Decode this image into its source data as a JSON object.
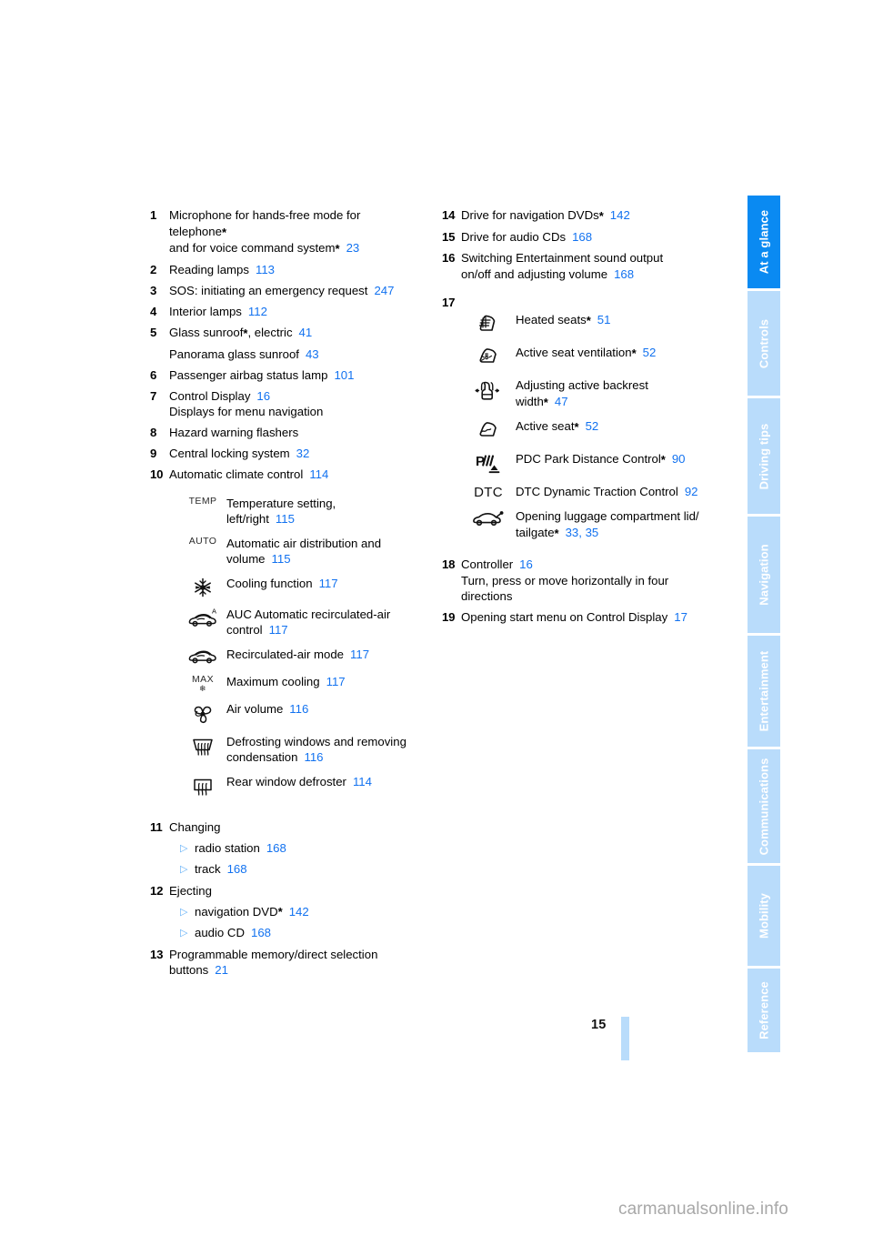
{
  "page": {
    "number": "15",
    "watermark": "carmanualsonline.info"
  },
  "tabs": [
    {
      "label": "At a glance",
      "active": true
    },
    {
      "label": "Controls",
      "active": false
    },
    {
      "label": "Driving tips",
      "active": false
    },
    {
      "label": "Navigation",
      "active": false
    },
    {
      "label": "Entertainment",
      "active": false
    },
    {
      "label": "Communications",
      "active": false
    },
    {
      "label": "Mobility",
      "active": false
    },
    {
      "label": "Reference",
      "active": false
    }
  ],
  "colors": {
    "reference_blue": "#1272f0",
    "tab_active": "#0a8af2",
    "tab_inactive": "#b9dcfb",
    "bullet_blue": "#63b0f7"
  },
  "left_column": {
    "items": [
      {
        "num": "1",
        "lines": [
          {
            "text": "Microphone for hands-free mode for"
          },
          {
            "text": "telephone",
            "star": true
          },
          {
            "text": "and for voice command system",
            "star": true,
            "ref": "23"
          }
        ]
      },
      {
        "num": "2",
        "lines": [
          {
            "text": "Reading lamps",
            "ref": "113"
          }
        ]
      },
      {
        "num": "3",
        "lines": [
          {
            "text": "SOS: initiating an emergency request",
            "ref": "247"
          }
        ]
      },
      {
        "num": "4",
        "lines": [
          {
            "text": "Interior lamps",
            "ref": "112"
          }
        ]
      },
      {
        "num": "5",
        "lines": [
          {
            "text": "Glass sunroof",
            "star": true,
            "suffix": ", electric",
            "ref": "41"
          },
          {
            "text": "Panorama glass sunroof",
            "ref": "43",
            "spaced": true
          }
        ]
      },
      {
        "num": "6",
        "lines": [
          {
            "text": "Passenger airbag status lamp",
            "ref": "101"
          }
        ]
      },
      {
        "num": "7",
        "lines": [
          {
            "text": "Control Display",
            "ref": "16"
          },
          {
            "text": "Displays for menu navigation"
          }
        ]
      },
      {
        "num": "8",
        "lines": [
          {
            "text": "Hazard warning flashers"
          }
        ]
      },
      {
        "num": "9",
        "lines": [
          {
            "text": "Central locking system",
            "ref": "32"
          }
        ]
      },
      {
        "num": "10",
        "lines": [
          {
            "text": "Automatic climate control",
            "ref": "114"
          }
        ]
      }
    ],
    "climate_icons": [
      {
        "icon": "temp-icon",
        "glyph": "TEMP",
        "line1": "Temperature setting,",
        "line2": "left/right",
        "ref": "115"
      },
      {
        "icon": "auto-icon",
        "glyph": "AUTO",
        "line1": "Automatic air distribution and",
        "line2": "volume",
        "ref": "115"
      },
      {
        "icon": "snowflake-icon",
        "line1": "Cooling function",
        "ref": "117"
      },
      {
        "icon": "auc-recirculation-icon",
        "line1": "AUC Automatic recirculated-air",
        "line2": "control",
        "ref": "117"
      },
      {
        "icon": "recirculation-icon",
        "line1": "Recirculated-air mode",
        "ref": "117"
      },
      {
        "icon": "max-cooling-icon",
        "glyph": "MAX",
        "line1": "Maximum cooling",
        "ref": "117"
      },
      {
        "icon": "fan-icon",
        "line1": "Air volume",
        "ref": "116"
      },
      {
        "icon": "windshield-defrost-icon",
        "line1": "Defrosting windows and removing",
        "line2": "condensation",
        "ref": "116"
      },
      {
        "icon": "rear-defrost-icon",
        "line1": "Rear window defroster",
        "ref": "114"
      }
    ],
    "items_bottom": [
      {
        "num": "11",
        "title": "Changing",
        "subs": [
          {
            "text": "radio station",
            "ref": "168"
          },
          {
            "text": "track",
            "ref": "168"
          }
        ]
      },
      {
        "num": "12",
        "title": "Ejecting",
        "subs": [
          {
            "text": "navigation DVD",
            "star": true,
            "ref": "142"
          },
          {
            "text": "audio CD",
            "ref": "168"
          }
        ]
      },
      {
        "num": "13",
        "lines": [
          {
            "text": "Programmable memory/direct selection"
          },
          {
            "text": "buttons",
            "ref": "21"
          }
        ]
      }
    ]
  },
  "right_column": {
    "items_top": [
      {
        "num": "14",
        "lines": [
          {
            "text": "Drive for navigation DVDs",
            "star": true,
            "ref": "142"
          }
        ]
      },
      {
        "num": "15",
        "lines": [
          {
            "text": "Drive for audio CDs",
            "ref": "168"
          }
        ]
      },
      {
        "num": "16",
        "lines": [
          {
            "text": "Switching Entertainment sound output"
          },
          {
            "text": "on/off and adjusting volume",
            "ref": "168"
          }
        ]
      }
    ],
    "seat_group_num": "17",
    "seat_icons": [
      {
        "icon": "heated-seat-icon",
        "line1": "Heated seats",
        "star": true,
        "ref": "51"
      },
      {
        "icon": "seat-ventilation-icon",
        "line1": "Active seat ventilation",
        "star": true,
        "ref": "52"
      },
      {
        "icon": "backrest-width-icon",
        "line1": "Adjusting active backrest",
        "line2": "width",
        "star2": true,
        "ref": "47"
      },
      {
        "icon": "active-seat-icon",
        "line1": "Active seat",
        "star": true,
        "ref": "52"
      },
      {
        "icon": "pdc-icon",
        "line1": "PDC Park Distance Control",
        "star": true,
        "ref": "90"
      },
      {
        "icon": "dtc-icon",
        "glyph": "DTC",
        "line1": "DTC Dynamic Traction Control",
        "ref": "92"
      },
      {
        "icon": "trunk-open-icon",
        "line1": "Opening luggage compartment lid/",
        "line2": "tailgate",
        "star2": true,
        "ref": "33, 35"
      }
    ],
    "items_bottom": [
      {
        "num": "18",
        "lines": [
          {
            "text": "Controller",
            "ref": "16"
          },
          {
            "text": "Turn, press or move horizontally in four"
          },
          {
            "text": "directions"
          }
        ]
      },
      {
        "num": "19",
        "lines": [
          {
            "text": "Opening start menu on Control Display",
            "ref": "17"
          }
        ]
      }
    ]
  }
}
